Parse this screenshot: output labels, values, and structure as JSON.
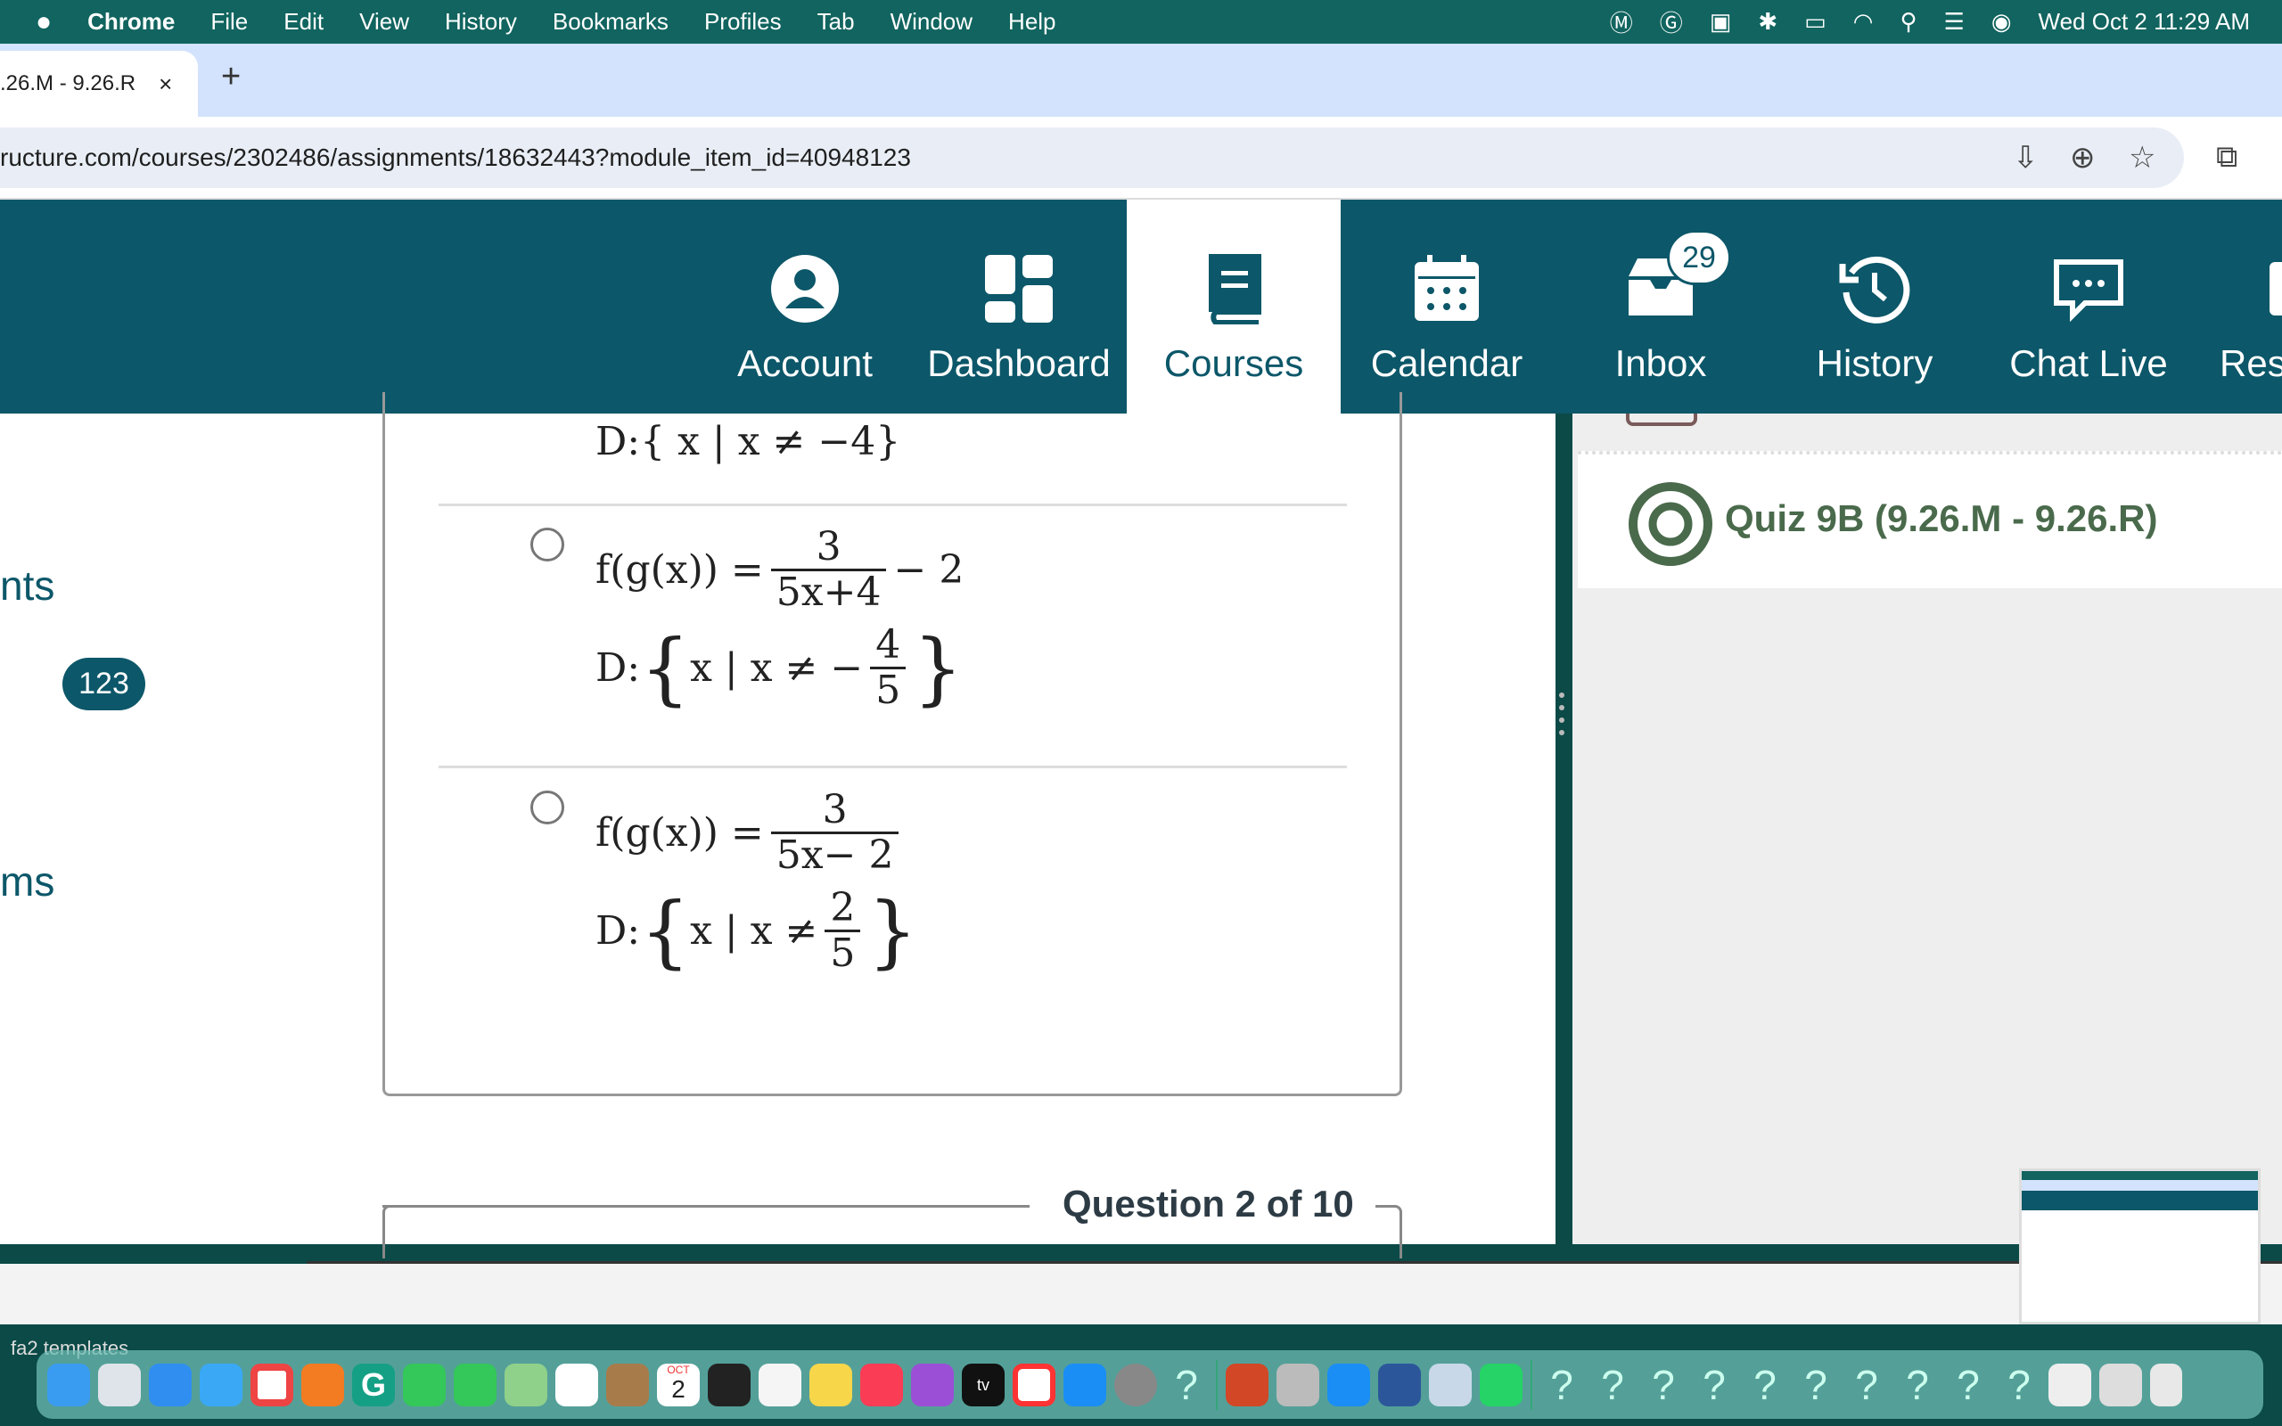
{
  "menubar": {
    "app": "Chrome",
    "items": [
      "File",
      "Edit",
      "View",
      "History",
      "Bookmarks",
      "Profiles",
      "Tab",
      "Window",
      "Help"
    ],
    "datetime": "Wed Oct 2  11:29 AM"
  },
  "browser": {
    "tab_title": ".26.M - 9.26.R",
    "close": "×",
    "new_tab": "+",
    "url": "ructure.com/courses/2302486/assignments/18632443?module_item_id=40948123"
  },
  "global_nav": {
    "items": [
      {
        "label": "Account",
        "icon": "account-icon"
      },
      {
        "label": "Dashboard",
        "icon": "dashboard-icon"
      },
      {
        "label": "Courses",
        "icon": "courses-icon",
        "active": true
      },
      {
        "label": "Calendar",
        "icon": "calendar-icon"
      },
      {
        "label": "Inbox",
        "icon": "inbox-icon",
        "badge": "29"
      },
      {
        "label": "History",
        "icon": "history-icon"
      },
      {
        "label": "Chat Live",
        "icon": "chat-icon"
      },
      {
        "label": "Res",
        "icon": "resources-icon"
      }
    ]
  },
  "course_nav": {
    "item1": "nts",
    "badge": "123",
    "item2": "ms"
  },
  "quiz": {
    "prev_domain": {
      "prefix": "D:",
      "set": "{ x | x ≠ −4}"
    },
    "options": [
      {
        "lhs": "f(g(x)) =",
        "num": "3",
        "den": "5x+4",
        "tail": "− 2",
        "d_prefix": "D:",
        "d_set": "x | x ≠ −",
        "d_num": "4",
        "d_den": "5"
      },
      {
        "lhs": "f(g(x)) =",
        "num": "3",
        "den": "5x− 2",
        "tail": "",
        "d_prefix": "D:",
        "d_set": "x | x ≠",
        "d_num": "2",
        "d_den": "5"
      }
    ],
    "question_counter": "Question 2 of 10"
  },
  "right_panel": {
    "quiz_title": "Quiz 9B (9.26.M - 9.26.R)"
  },
  "desktop": {
    "label": "fa2 templates",
    "dock_calendar_month": "OCT",
    "dock_calendar_day": "2",
    "dock_tv": "tv"
  },
  "colors": {
    "nav": "#0c5769",
    "menubar": "#11645f",
    "quiz_green": "#4a6a4c"
  }
}
